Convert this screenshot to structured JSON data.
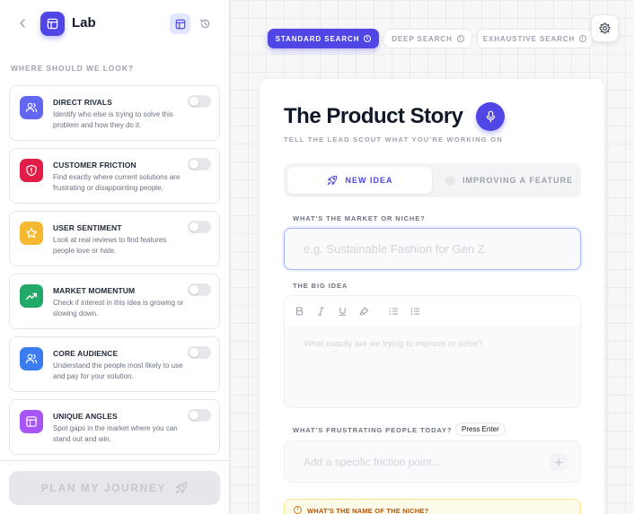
{
  "app": {
    "title": "Lab"
  },
  "sidebar": {
    "section_label": "WHERE SHOULD WE LOOK?",
    "cards": [
      {
        "title": "DIRECT RIVALS",
        "desc": "Identify who else is trying to solve this problem and how they do it.",
        "icon": "users-icon",
        "color": "#6366f1",
        "enabled": false
      },
      {
        "title": "CUSTOMER FRICTION",
        "desc": "Find exactly where current solutions are frustrating or disappointing people.",
        "icon": "shield-alert-icon",
        "color": "#e11d48",
        "enabled": false
      },
      {
        "title": "USER SENTIMENT",
        "desc": "Look at real reviews to find features people love or hate.",
        "icon": "star-icon",
        "color": "#f5b82e",
        "enabled": false
      },
      {
        "title": "MARKET MOMENTUM",
        "desc": "Check if interest in this idea is growing or slowing down.",
        "icon": "trending-up-icon",
        "color": "#22a867",
        "enabled": false
      },
      {
        "title": "CORE AUDIENCE",
        "desc": "Understand the people most likely to use and pay for your solution.",
        "icon": "users-icon",
        "color": "#3b7cf0",
        "enabled": false
      },
      {
        "title": "UNIQUE ANGLES",
        "desc": "Spot gaps in the market where you can stand out and win.",
        "icon": "layout-icon",
        "color": "#a855f7",
        "enabled": false
      }
    ],
    "plan_button": "PLAN MY JOURNEY"
  },
  "modes": {
    "standard": "STANDARD SEARCH",
    "deep": "DEEP SEARCH",
    "exhaustive": "EXHAUSTIVE SEARCH",
    "active": "standard"
  },
  "panel": {
    "title": "The Product Story",
    "subtitle": "TELL THE LEAD SCOUT WHAT YOU'RE WORKING ON",
    "seg_new": "NEW IDEA",
    "seg_improve": "IMPROVING A FEATURE",
    "market_label": "WHAT'S THE MARKET OR NICHE?",
    "market_placeholder": "e.g. Sustainable Fashion for Gen Z",
    "market_value": "",
    "idea_label": "THE BIG IDEA",
    "idea_placeholder": "What exactly are we trying to improve or solve?",
    "friction_label": "WHAT'S FRUSTRATING PEOPLE TODAY?",
    "press_enter": "Press Enter",
    "friction_placeholder": "Add a specific friction point...",
    "alert_text": "WHAT'S THE NAME OF THE NICHE?"
  },
  "colors": {
    "accent": "#4f46e5",
    "warning": "#d97706"
  }
}
